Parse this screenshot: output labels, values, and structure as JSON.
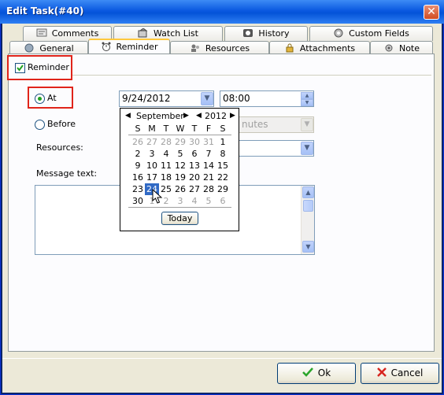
{
  "window": {
    "title": "Edit Task(#40)"
  },
  "tabs_row1": [
    {
      "label": "Comments",
      "icon": "comments-icon"
    },
    {
      "label": "Watch List",
      "icon": "watch-list-icon"
    },
    {
      "label": "History",
      "icon": "history-icon"
    },
    {
      "label": "Custom Fields",
      "icon": "custom-fields-icon"
    }
  ],
  "tabs_row2": [
    {
      "label": "General",
      "icon": "general-icon"
    },
    {
      "label": "Reminder",
      "icon": "alarm-clock-icon",
      "active": true
    },
    {
      "label": "Resources",
      "icon": "resources-icon"
    },
    {
      "label": "Attachments",
      "icon": "lock-icon"
    },
    {
      "label": "Note",
      "icon": "note-icon"
    }
  ],
  "reminder": {
    "checkbox_label": "Reminder",
    "checked": true,
    "at_label": "At",
    "at_selected": true,
    "date_value": "9/24/2012",
    "time_value": "08:00",
    "before_label": "Before",
    "before_unit": "nutes",
    "resources_label": "Resources:",
    "message_label": "Message text:"
  },
  "calendar": {
    "month": "September",
    "year": "2012",
    "weekdays": [
      "S",
      "M",
      "T",
      "W",
      "T",
      "F",
      "S"
    ],
    "weeks": [
      [
        "26",
        "27",
        "28",
        "29",
        "30",
        "31",
        "1"
      ],
      [
        "2",
        "3",
        "4",
        "5",
        "6",
        "7",
        "8"
      ],
      [
        "9",
        "10",
        "11",
        "12",
        "13",
        "14",
        "15"
      ],
      [
        "16",
        "17",
        "18",
        "19",
        "20",
        "21",
        "22"
      ],
      [
        "23",
        "24",
        "25",
        "26",
        "27",
        "28",
        "29"
      ],
      [
        "30",
        "1",
        "2",
        "3",
        "4",
        "5",
        "6"
      ]
    ],
    "selected": "24",
    "today_label": "Today"
  },
  "buttons": {
    "ok": "Ok",
    "cancel": "Cancel"
  },
  "colors": {
    "highlight": "#e0241a",
    "selected_day": "#316ac5",
    "ok_icon": "#2ba52b",
    "cancel_icon": "#d7261f"
  }
}
